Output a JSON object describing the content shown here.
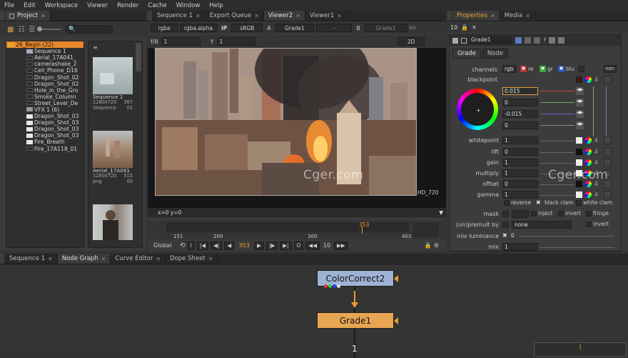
{
  "menu": [
    "File",
    "Edit",
    "Workspace",
    "Viewer",
    "Render",
    "Cache",
    "Window",
    "Help"
  ],
  "project_tab": "Project",
  "project_tree": [
    {
      "label": "26_Begin (22)",
      "level": 0,
      "selected": true,
      "icon": "folder-icon"
    },
    {
      "label": "Sequence 1",
      "level": 1,
      "icon": "sequence-icon"
    },
    {
      "label": "Aerial_17A041_",
      "level": 1,
      "icon": "clip-icon"
    },
    {
      "label": "camerashake_2",
      "level": 1,
      "icon": "clip-icon"
    },
    {
      "label": "Cell_Phone_D16",
      "level": 1,
      "icon": "clip-icon"
    },
    {
      "label": "Dragon_Shot_02",
      "level": 1,
      "icon": "clip-icon"
    },
    {
      "label": "Dragon_Shot_02",
      "level": 1,
      "icon": "clip-icon"
    },
    {
      "label": "Hole_in_the_Gro",
      "level": 1,
      "icon": "clip-icon"
    },
    {
      "label": "Smoke_Column",
      "level": 1,
      "icon": "clip-icon"
    },
    {
      "label": "Street_Level_De",
      "level": 1,
      "icon": "clip-icon"
    },
    {
      "label": "VFX 1 (6)",
      "level": 1,
      "icon": "bin-icon"
    },
    {
      "label": "Dragon_Shot_03",
      "level": 1,
      "icon": "white-clip-icon"
    },
    {
      "label": "Dragon_Shot_03",
      "level": 1,
      "icon": "white-clip-icon"
    },
    {
      "label": "Dragon_Shot_03",
      "level": 1,
      "icon": "white-clip-icon"
    },
    {
      "label": "Dragon_Shot_03",
      "level": 1,
      "icon": "white-clip-icon"
    },
    {
      "label": "Fire_Breath",
      "level": 1,
      "icon": "white-clip-icon"
    },
    {
      "label": "Fire_17A118_01",
      "level": 1,
      "icon": "clip-icon"
    }
  ],
  "thumbs": [
    {
      "name": "Sequence 1",
      "res": "1280x720",
      "fr": "367",
      "type": "Sequence",
      "n": "01"
    },
    {
      "name": "Aerial_17A041",
      "res": "1280x720",
      "fr": "515",
      "type": "png",
      "n": "00"
    }
  ],
  "viewer_tabs": [
    "Sequence 1",
    "Export Queue",
    "Viewer2",
    "Viewer1"
  ],
  "viewer_toolbar": {
    "channels": "rgba",
    "alpha": "rgba.alpha",
    "ip": "IP",
    "colorspace": "sRGB",
    "a_label": "A",
    "a_input": "Grade1",
    "dash": "-",
    "b_label": "B",
    "b_input": "Grade1"
  },
  "viewer_toolbar2": {
    "fstop": "f/8",
    "frame": "1",
    "y_label": "Y",
    "y_val": "1",
    "mode": "2D"
  },
  "format_label": "HD_720",
  "coords": "x=0 y=0",
  "timeline": {
    "current": "353",
    "ticks": [
      "151",
      "200",
      "300",
      "403"
    ],
    "global": "Global",
    "frame": "353",
    "step": "10"
  },
  "props_tabs": [
    "Properties",
    "Media"
  ],
  "props_header": {
    "count": "10",
    "node": "Grade1"
  },
  "props_subtabs": [
    "Grade",
    "Node"
  ],
  "params": {
    "channels": "channels",
    "channels_val": "rgb",
    "r": "re",
    "g": "gr",
    "b": "blu",
    "none": "non",
    "blackpoint": "blackpoint",
    "bp_values": [
      "0.015",
      "0",
      "-0.015",
      "0"
    ],
    "bp_badge": "4",
    "whitepoint": "whitepoint",
    "whitepoint_val": "1",
    "lift": "lift",
    "lift_val": "0",
    "gain": "gain",
    "gain_val": "1",
    "multiply": "multiply",
    "multiply_val": "1",
    "offset": "offset",
    "offset_val": "0",
    "gamma": "gamma",
    "gamma_val": "1",
    "reverse": "reverse",
    "black_clamp": "black clam",
    "white_clamp": "white clam",
    "mask": "mask",
    "inject": "inject",
    "invert": "invert",
    "fringe": "fringe",
    "unpremult": "(un)premult by",
    "unpremult_val": "none",
    "invert2": "invert",
    "mix_lum": "mix luminance",
    "mix_lum_val": "0",
    "mix": "mix",
    "mix_val": "1"
  },
  "graph_tabs": [
    "Sequence 1",
    "Node Graph",
    "Curve Editor",
    "Dope Sheet"
  ],
  "nodes": [
    {
      "label": "ColorCorrect2",
      "color": "#9eb3d4"
    },
    {
      "label": "Grade1",
      "color": "#e8a552"
    }
  ],
  "node_input": "1",
  "watermark": "Cger.com",
  "colors": {
    "accent": "#f0a030",
    "selected": "#e8882a"
  }
}
